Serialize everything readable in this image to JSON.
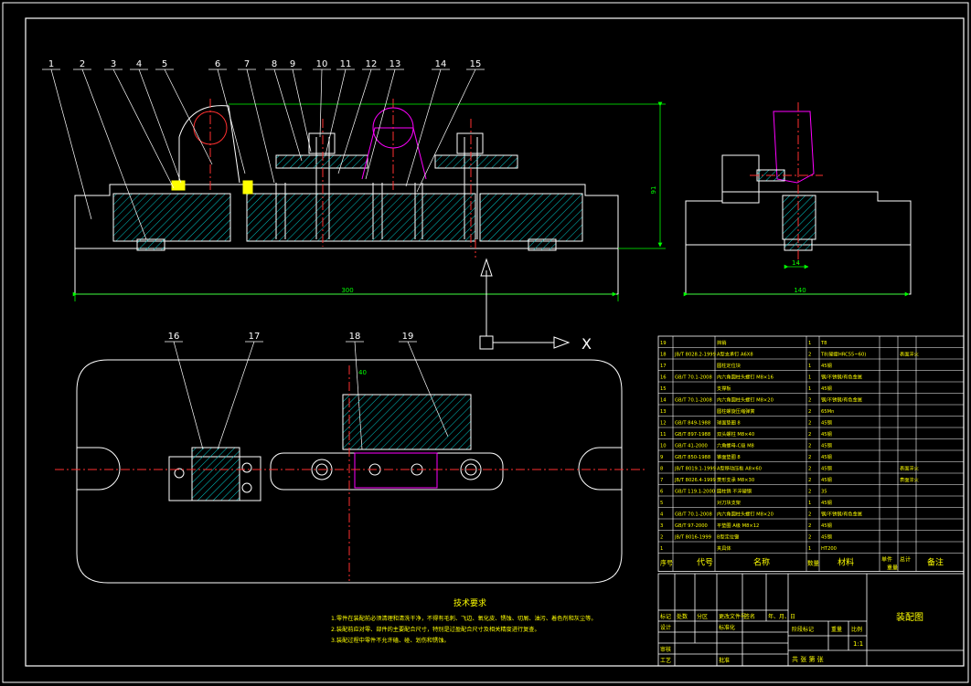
{
  "colors": {
    "background": "#000000",
    "outline": "#ffffff",
    "hatch": "#00c8c8",
    "center": "#ff3030",
    "dimension": "#00ff00",
    "highlight": "#ff00ff",
    "accent": "#ffff00"
  },
  "balloons": [
    "1",
    "2",
    "3",
    "4",
    "5",
    "6",
    "7",
    "8",
    "9",
    "10",
    "11",
    "12",
    "13",
    "14",
    "15",
    "16",
    "17",
    "18",
    "19"
  ],
  "dims": {
    "total_length": "300",
    "height": "91",
    "side_width": "140",
    "side_small": "14",
    "top_small": "40"
  },
  "axis_label": "X",
  "notes": {
    "title": "技术要求",
    "lines": [
      "1.零件在装配前必须清理和清洗干净，不得有毛刺、飞边、氧化皮、锈蚀、切屑、油污、着色剂和灰尘等。",
      "2.装配前应对零、部件的主要配合尺寸，特别是过盈配合尺寸及相关精度进行复查。",
      "3.装配过程中零件不允许磕、碰、划伤和锈蚀。"
    ]
  },
  "bom": {
    "headers": {
      "no": "序号",
      "code": "代号",
      "name": "名称",
      "qty": "数量",
      "material": "材料",
      "single": "单件",
      "total": "总计",
      "weight": "重量",
      "remark": "备注"
    },
    "rows": [
      {
        "no": "19",
        "code": "",
        "name": "挡销",
        "qty": "1",
        "material": "T8",
        "remark": ""
      },
      {
        "no": "18",
        "code": "JB/T 8028.2-1999",
        "name": "A型支承钉 A6X8",
        "qty": "2",
        "material": "T8(硬度HRC55~60)",
        "remark": "表面淬火"
      },
      {
        "no": "17",
        "code": "",
        "name": "圆柱定位块",
        "qty": "1",
        "material": "45钢",
        "remark": ""
      },
      {
        "no": "16",
        "code": "GB/T 70.1-2008",
        "name": "内六角圆柱头螺钉 M8×16",
        "qty": "1",
        "material": "钢/不锈钢/有色金属",
        "remark": ""
      },
      {
        "no": "15",
        "code": "",
        "name": "支撑板",
        "qty": "1",
        "material": "45钢",
        "remark": ""
      },
      {
        "no": "14",
        "code": "GB/T 70.1-2008",
        "name": "内六角圆柱头螺钉 M8×20",
        "qty": "2",
        "material": "钢/不锈钢/有色金属",
        "remark": ""
      },
      {
        "no": "13",
        "code": "",
        "name": "圆柱螺旋压缩弹簧",
        "qty": "2",
        "material": "65Mn",
        "remark": ""
      },
      {
        "no": "12",
        "code": "GB/T 849-1988",
        "name": "球面垫圈 8",
        "qty": "2",
        "material": "45钢",
        "remark": ""
      },
      {
        "no": "11",
        "code": "GB/T 897-1988",
        "name": "双头螺柱 M8×40",
        "qty": "2",
        "material": "45钢",
        "remark": ""
      },
      {
        "no": "10",
        "code": "GB/T 41-2000",
        "name": "六角螺母-C级 M8",
        "qty": "2",
        "material": "45钢",
        "remark": ""
      },
      {
        "no": "9",
        "code": "GB/T 850-1988",
        "name": "锥面垫圈 8",
        "qty": "2",
        "material": "45钢",
        "remark": ""
      },
      {
        "no": "8",
        "code": "JB/T 8019.1-1999",
        "name": "A型移动压板 A8×60",
        "qty": "2",
        "material": "45钢",
        "remark": "表面淬火"
      },
      {
        "no": "7",
        "code": "JB/T 8026.4-1999",
        "name": "菱形支承 M8×30",
        "qty": "2",
        "material": "45钢",
        "remark": "表面淬火"
      },
      {
        "no": "6",
        "code": "GB/T 119.1-2000",
        "name": "圆柱销 不淬硬钢",
        "qty": "2",
        "material": "35",
        "remark": ""
      },
      {
        "no": "5",
        "code": "",
        "name": "对刀块支架",
        "qty": "1",
        "material": "45钢",
        "remark": ""
      },
      {
        "no": "4",
        "code": "GB/T 70.1-2008",
        "name": "内六角圆柱头螺钉 M8×20",
        "qty": "2",
        "material": "钢/不锈钢/有色金属",
        "remark": ""
      },
      {
        "no": "3",
        "code": "GB/T 97-2000",
        "name": "平垫圈 A级 M8×12",
        "qty": "2",
        "material": "45钢",
        "remark": ""
      },
      {
        "no": "2",
        "code": "JB/T 8016-1999",
        "name": "B型定位键",
        "qty": "2",
        "material": "45钢",
        "remark": ""
      },
      {
        "no": "1",
        "code": "",
        "name": "夹具体",
        "qty": "1",
        "material": "HT200",
        "remark": ""
      }
    ]
  },
  "title_block": {
    "drawing_name": "装配图",
    "scale": "1:1",
    "row_labels": [
      "标记",
      "设计",
      "审核",
      "工艺"
    ],
    "col_labels": [
      "处数",
      "分区",
      "更改文件号",
      "签名",
      "年、月、日"
    ],
    "std_label": "标准化",
    "approve_label": "批准",
    "stage_label": "阶段标记",
    "weight_label": "重量",
    "scale_label": "比例",
    "sheets_label": "共 张 第 张"
  }
}
